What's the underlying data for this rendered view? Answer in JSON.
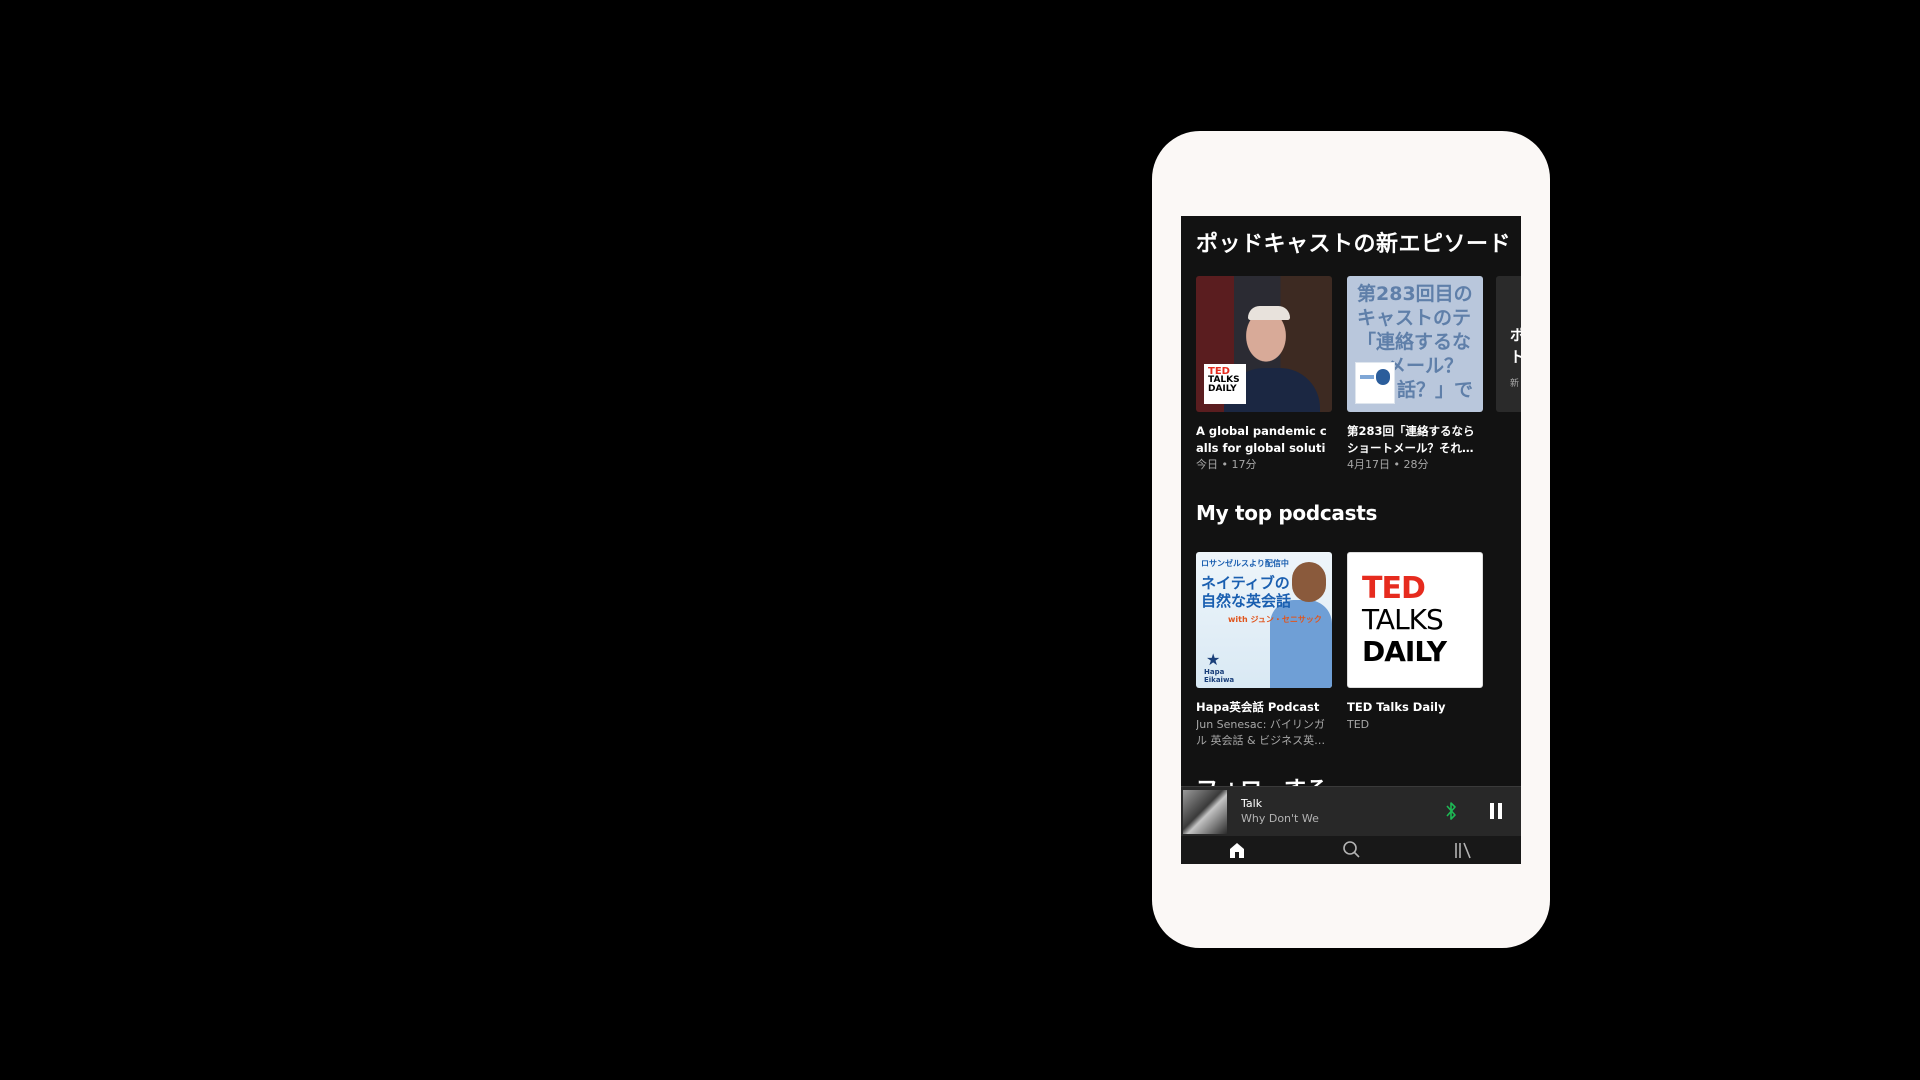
{
  "sections": {
    "new_episodes": {
      "title": "ポッドキャストの新エピソード",
      "cards": [
        {
          "title": "A global pandemic calls for global solutions | L…",
          "meta": "今日 • 17分",
          "art_text": [
            "TED",
            "TALKS",
            "DAILY"
          ]
        },
        {
          "title": "第283回「連絡するならショートメール？それ…",
          "meta": "4月17日 • 28分",
          "art_lines": [
            "第283回目の",
            "キャストのテ",
            "「連絡するな",
            "メール？",
            "話？」で"
          ]
        }
      ],
      "partial_card": {
        "line1": "ポ",
        "line2": "ト",
        "line3": "新"
      }
    },
    "top_podcasts": {
      "title": "My top podcasts",
      "cards": [
        {
          "title": "Hapa英会話 Podcast",
          "subtitle": "Jun Senesac: バイリンガル 英会話 & ビジネス英…",
          "art": {
            "tag": "ロサンゼルスより配信中",
            "headline1": "ネイティブの",
            "headline2": "自然な英会話",
            "with": "with ジュン・セニサック",
            "logo1": "Hapa",
            "logo2": "Eikaiwa"
          }
        },
        {
          "title": "TED Talks Daily",
          "subtitle": "TED",
          "art": {
            "line1": "TED",
            "line2": "TALKS",
            "line3": "DAILY"
          }
        }
      ]
    },
    "cut_off_section": {
      "title": "フォローする"
    }
  },
  "player": {
    "song": "Talk",
    "artist": "Why Don't We",
    "accent": "#1db954"
  },
  "tabs": [
    {
      "name": "home",
      "icon": "home-icon",
      "active": true
    },
    {
      "name": "search",
      "icon": "search-icon",
      "active": false
    },
    {
      "name": "library",
      "icon": "library-icon",
      "active": false
    }
  ],
  "colors": {
    "background": "#121212",
    "phone_shell": "#fbf8f6",
    "ted_red": "#e62b1e"
  }
}
